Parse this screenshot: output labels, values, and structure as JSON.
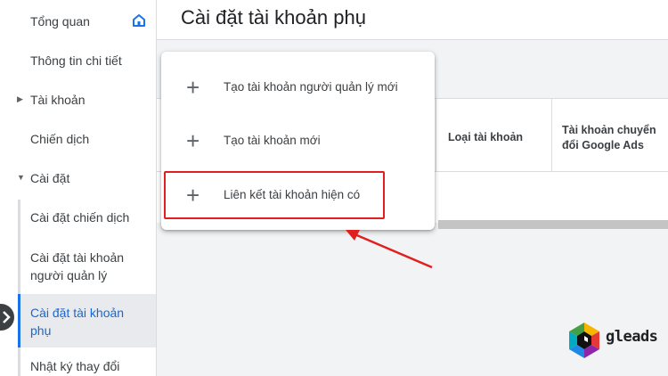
{
  "sidebar": {
    "items": [
      {
        "label": "Tổng quan"
      },
      {
        "label": "Thông tin chi tiết"
      },
      {
        "label": "Tài khoản"
      },
      {
        "label": "Chiến dịch"
      },
      {
        "label": "Cài đặt"
      },
      {
        "label": "Cài đặt chiến dịch"
      },
      {
        "label": "Cài đặt tài khoản người quản lý"
      },
      {
        "label": "Cài đặt tài khoản phụ",
        "active": true
      },
      {
        "label": "Nhật ký thay đổi"
      }
    ]
  },
  "header": {
    "title": "Cài đặt tài khoản phụ"
  },
  "table": {
    "columns": [
      "Loại tài khoản",
      "Tài khoản chuyển đổi Google Ads"
    ]
  },
  "menu": {
    "items": [
      {
        "label": "Tạo tài khoản người quản lý mới",
        "icon": "plus-icon"
      },
      {
        "label": "Tạo tài khoản mới",
        "icon": "plus-icon"
      },
      {
        "label": "Liên kết tài khoản hiện có",
        "icon": "plus-icon",
        "highlighted": true
      }
    ]
  },
  "logo": {
    "text": "gleads"
  },
  "colors": {
    "accent": "#1a73e8",
    "active_text": "#1967d2",
    "highlight": "#e02020"
  }
}
